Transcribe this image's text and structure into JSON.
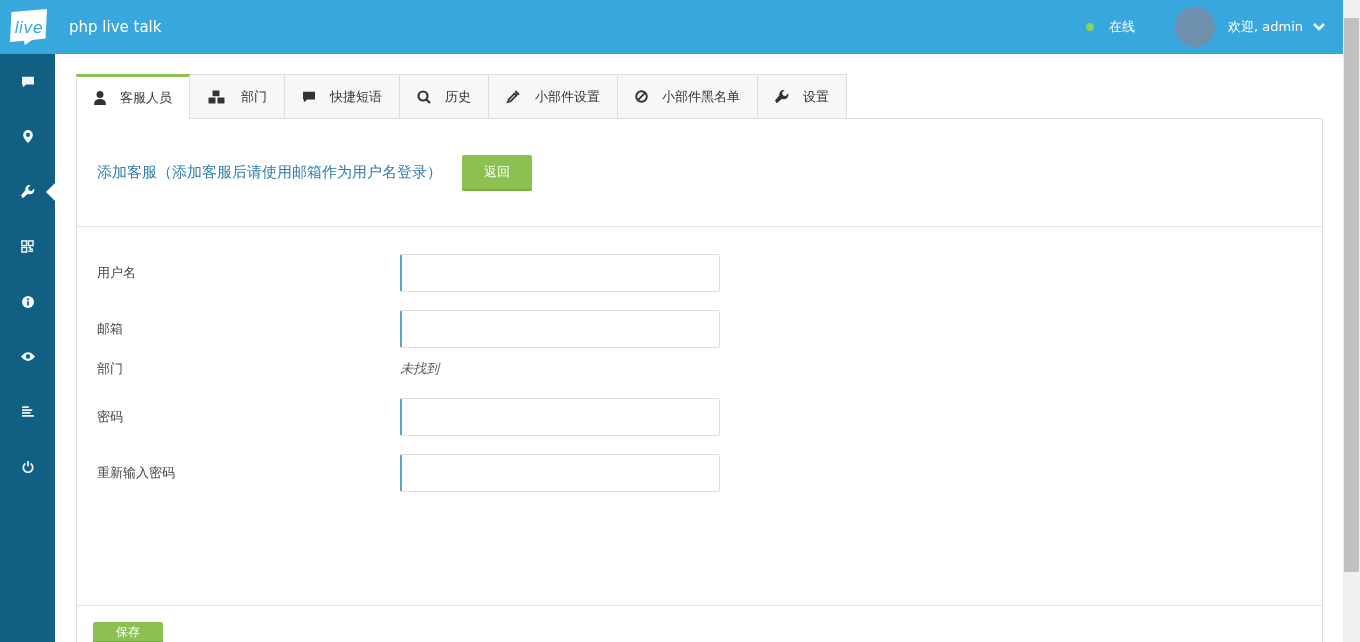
{
  "header": {
    "logo": "live",
    "title": "php live talk",
    "status": "在线",
    "welcome": "欢迎, admin"
  },
  "sidebar": {
    "items": [
      {
        "selected": false
      },
      {
        "selected": false
      },
      {
        "selected": true
      },
      {
        "selected": false
      },
      {
        "selected": false
      },
      {
        "selected": false
      },
      {
        "selected": false
      },
      {
        "selected": false
      }
    ]
  },
  "tabs": [
    {
      "label": "客服人员",
      "selected": true
    },
    {
      "label": "部门",
      "selected": false
    },
    {
      "label": "快捷短语",
      "selected": false
    },
    {
      "label": "历史",
      "selected": false
    },
    {
      "label": "小部件设置",
      "selected": false
    },
    {
      "label": "小部件黑名单",
      "selected": false
    },
    {
      "label": "设置",
      "selected": false
    }
  ],
  "panel": {
    "heading": "添加客服（添加客服后请使用邮箱作为用户名登录）",
    "back_button": "返回",
    "fields": [
      {
        "label": "用户名",
        "kind": "input"
      },
      {
        "label": "邮箱",
        "kind": "input"
      },
      {
        "label": "部门",
        "kind": "text",
        "value": "未找到"
      },
      {
        "label": "密码",
        "kind": "input"
      },
      {
        "label": "重新输入密码",
        "kind": "input"
      }
    ],
    "save_button": "保存"
  }
}
